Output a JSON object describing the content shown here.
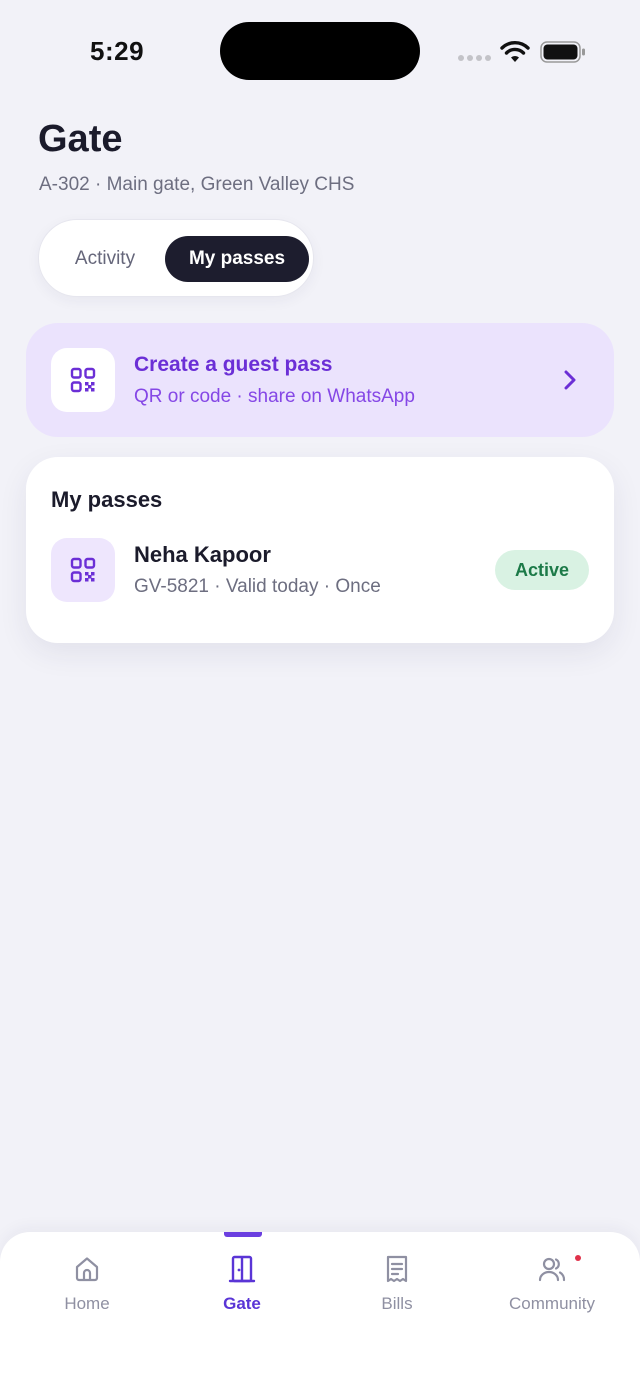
{
  "status_bar": {
    "time": "5:29"
  },
  "header": {
    "title": "Gate",
    "subtitle": "A-302 · Main gate, Green Valley CHS"
  },
  "segmented": {
    "activity_label": "Activity",
    "passes_label": "My passes",
    "selected": "My passes"
  },
  "guest_pass": {
    "title": "Create a guest pass",
    "subtitle": "QR or code · share on WhatsApp",
    "icon": "qr-code-icon"
  },
  "passes": {
    "heading": "My passes",
    "items": [
      {
        "name": "Neha Kapoor",
        "meta": "GV-5821 · Valid today · Once",
        "status": "Active",
        "icon": "qr-code-icon"
      }
    ]
  },
  "tab_bar": {
    "items": [
      {
        "label": "Home",
        "icon": "home-icon"
      },
      {
        "label": "Gate",
        "icon": "door-icon"
      },
      {
        "label": "Bills",
        "icon": "receipt-icon"
      },
      {
        "label": "Community",
        "icon": "users-icon"
      }
    ],
    "active": "Gate"
  },
  "colors": {
    "accent": "#6b2fd6",
    "background": "#f2f2f8",
    "dark": "#1d1d2e",
    "active_badge_bg": "#d9f2e3",
    "active_badge_text": "#1c7a48",
    "notification": "#e0314a"
  }
}
